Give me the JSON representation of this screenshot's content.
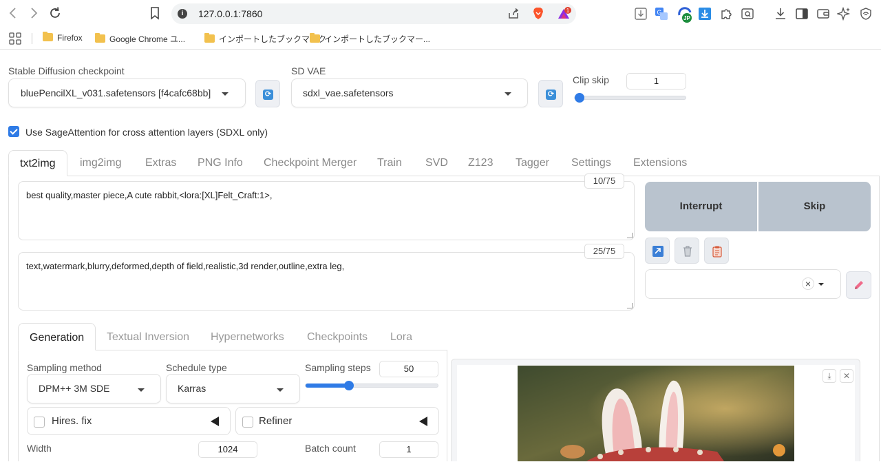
{
  "browser": {
    "url": "127.0.0.1:7860",
    "rewards_badge": "1",
    "ext_badge": "JP",
    "bookmarks": [
      {
        "label": "Firefox"
      },
      {
        "label": "Google Chrome ユ..."
      },
      {
        "label": "インポートしたブックマーク"
      },
      {
        "label": "インポートしたブックマー..."
      }
    ]
  },
  "settings": {
    "checkpoint_label": "Stable Diffusion checkpoint",
    "checkpoint_value": "bluePencilXL_v031.safetensors [f4cafc68bb]",
    "vae_label": "SD VAE",
    "vae_value": "sdxl_vae.safetensors",
    "clip_skip_label": "Clip skip",
    "clip_skip_value": "1",
    "clip_skip_level": 0,
    "sage_label": "Use SageAttention for cross attention layers (SDXL only)",
    "sage_checked": true
  },
  "main_tabs": [
    "txt2img",
    "img2img",
    "Extras",
    "PNG Info",
    "Checkpoint Merger",
    "Train",
    "SVD",
    "Z123",
    "Tagger",
    "Settings",
    "Extensions"
  ],
  "prompt": {
    "positive": "best quality,master piece,A cute rabbit,<lora:[XL]Felt_Craft:1>,",
    "positive_tokens": "10/75",
    "negative": "text,watermark,blurry,deformed,depth of field,realistic,3d render,outline,extra leg,",
    "negative_tokens": "25/75"
  },
  "actions": {
    "interrupt": "Interrupt",
    "skip": "Skip",
    "clear_symbol": "×"
  },
  "sub_tabs": [
    "Generation",
    "Textual Inversion",
    "Hypernetworks",
    "Checkpoints",
    "Lora"
  ],
  "generation": {
    "sampling_method_label": "Sampling method",
    "sampling_method_value": "DPM++ 3M SDE",
    "schedule_type_label": "Schedule type",
    "schedule_type_value": "Karras",
    "sampling_steps_label": "Sampling steps",
    "sampling_steps_value": "50",
    "sampling_steps_fraction": 0.33,
    "hires_label": "Hires. fix",
    "refiner_label": "Refiner",
    "width_label": "Width",
    "width_value": "1024",
    "batch_count_label": "Batch count",
    "batch_count_value": "1"
  },
  "gallery": {
    "download_symbol": "⤓",
    "close_symbol": "✕"
  },
  "colors": {
    "accent": "#2f7be6",
    "action_button": "#b9c3ce"
  }
}
